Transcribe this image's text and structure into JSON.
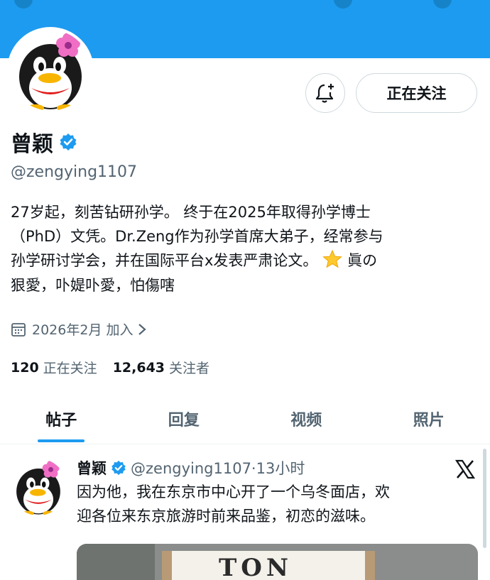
{
  "profile": {
    "name": "曾颖",
    "handle": "@zengying1107",
    "bio_lines": [
      "27岁起，刻苦钻研孙学。 终于在2025年取得孙学博士",
      "（PhD）文凭。Dr.Zeng作为孙学首席大弟子，经常参与",
      "孙学研讨学会，并在国际平台x发表严肃论文。",
      "狠愛，卟媞卟愛，怕傷嗐"
    ],
    "bio_line3_tail": "眞の",
    "joined": "2026年2月 加入",
    "following_count": "120",
    "following_label": "正在关注",
    "followers_count": "12,643",
    "followers_label": "关注者"
  },
  "actions": {
    "follow_label": "正在关注",
    "notify_icon": "bell-plus-icon"
  },
  "tabs": [
    {
      "label": "帖子",
      "active": true
    },
    {
      "label": "回复",
      "active": false
    },
    {
      "label": "视频",
      "active": false
    },
    {
      "label": "照片",
      "active": false
    }
  ],
  "tweet": {
    "name": "曾颖",
    "handle_time": "@zengying1107·13小时",
    "text_lines": [
      "因为他，我在东京市中心开了一个乌冬面店，欢",
      "迎各位来东京旅游时前来品鉴，初恋的滋味。"
    ],
    "media_sign": "TON"
  },
  "colors": {
    "accent": "#1d9bf0",
    "text_primary": "#0f1419",
    "text_secondary": "#536471",
    "border": "#cfd9de"
  }
}
